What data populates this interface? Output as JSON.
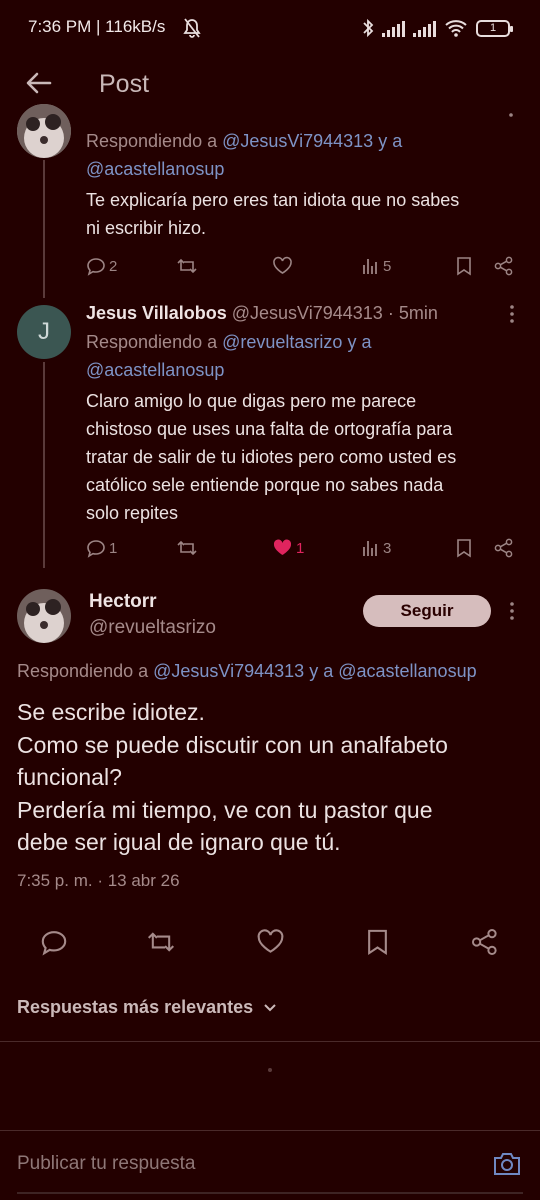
{
  "status_bar": {
    "time": "7:36 PM | 116kB/s",
    "battery": "1"
  },
  "header": {
    "title": "Post"
  },
  "reply1": {
    "replying_prefix": "Respondiendo a",
    "mention1": "@JesusVi7944313",
    "conjunction": "y a",
    "mention2": "@acastellanosup",
    "text_line1": "Te explicaría pero eres tan idiota que no sabes",
    "text_line2": "ni escribir hizo.",
    "replies": "2",
    "views": "5"
  },
  "reply2": {
    "author": "Jesus Villalobos",
    "handle": "@JesusVi7944313",
    "time": "· 5min",
    "avatar_letter": "J",
    "replying_prefix": "Respondiendo a",
    "mention1": "@revueltasrizo",
    "conjunction": "y a",
    "mention2": "@acastellanosup",
    "text_lines": [
      "Claro amigo lo que digas pero me parece",
      "chistoso que uses una falta de ortografía para",
      "tratar de salir de tu idiotes pero como usted es",
      "católico sele entiende porque no sabes nada",
      "solo repites"
    ],
    "replies": "1",
    "likes": "1",
    "views": "3"
  },
  "main_post": {
    "author": "Hectorr",
    "handle": "@revueltasrizo",
    "follow_label": "Seguir",
    "replying_prefix": "Respondiendo a",
    "mention1": "@JesusVi7944313",
    "conjunction": "y a",
    "mention2": "@acastellanosup",
    "text_lines": [
      "Se escribe idiotez.",
      "Como se puede discutir con un analfabeto",
      "funcional?",
      "Perdería mi tiempo, ve con tu pastor que",
      "debe ser igual de ignaro que tú."
    ],
    "timestamp": "7:35 p. m. · 13 abr 26"
  },
  "sort": {
    "label": "Respuestas más relevantes"
  },
  "composer": {
    "placeholder": "Publicar tu respuesta"
  },
  "colors": {
    "background": "#230000",
    "link": "#7e93c6",
    "like_active": "#e0245e",
    "follow_button": "#d6bdbd"
  }
}
